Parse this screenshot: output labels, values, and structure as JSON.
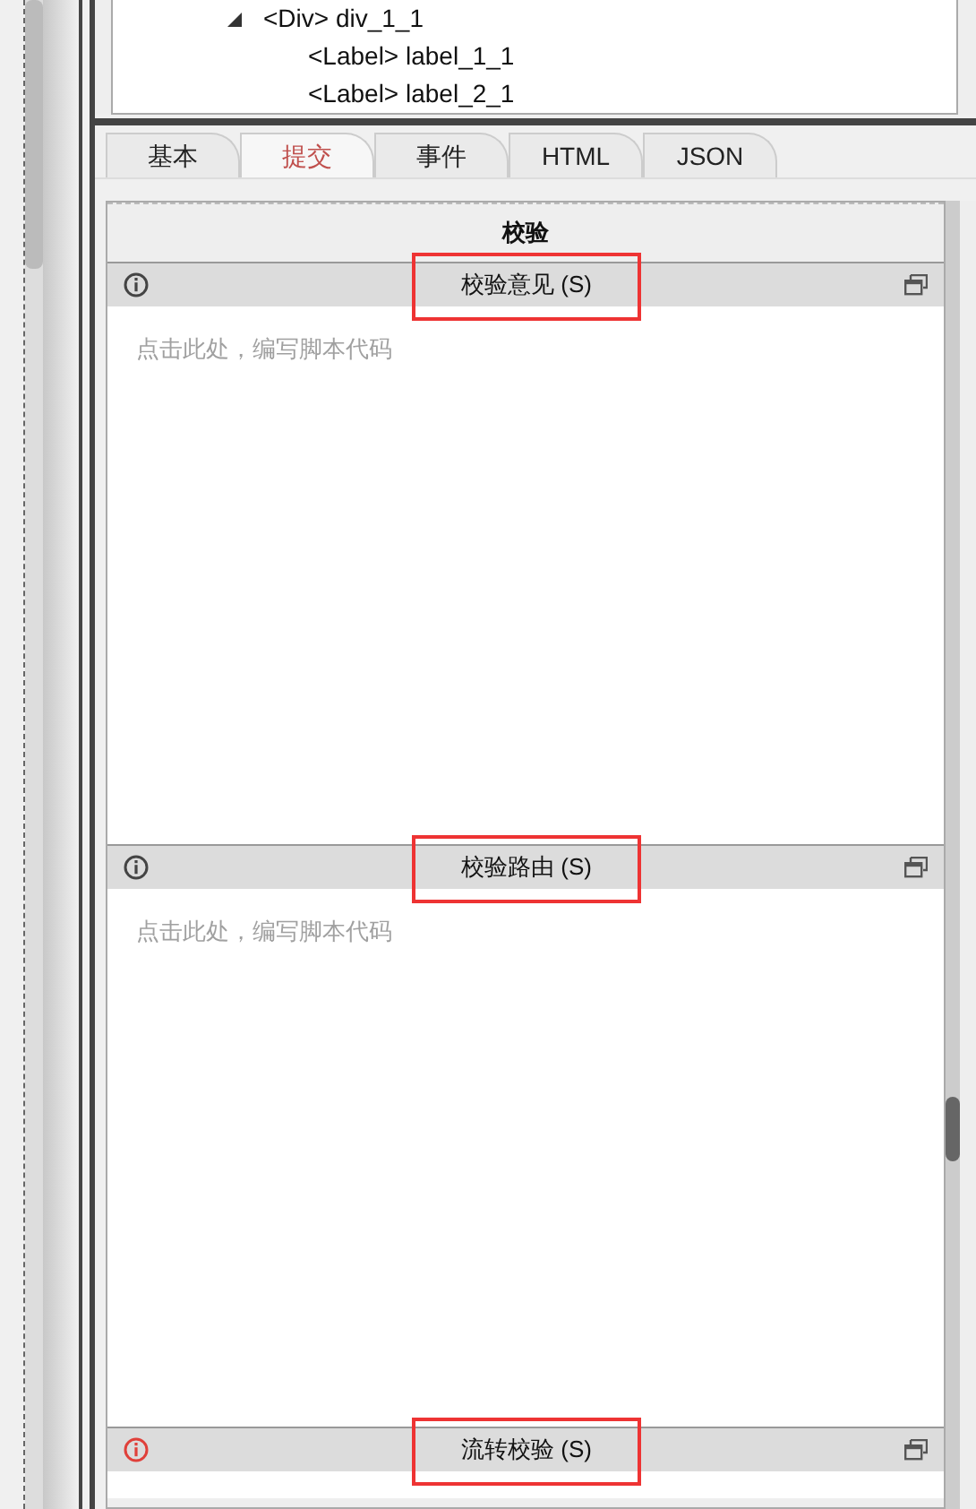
{
  "tree": {
    "items": [
      {
        "label": "<Div> div_1_1",
        "expanded": true,
        "children": [
          {
            "label": "<Label> label_1_1"
          },
          {
            "label": "<Label> label_2_1"
          }
        ]
      }
    ]
  },
  "tabs": [
    {
      "label": "基本",
      "selected": false
    },
    {
      "label": "提交",
      "selected": true
    },
    {
      "label": "事件",
      "selected": false
    },
    {
      "label": "HTML",
      "selected": false
    },
    {
      "label": "JSON",
      "selected": false
    }
  ],
  "panel": {
    "title": "校验",
    "sections": [
      {
        "title": "校验意见 (S)",
        "alert": false,
        "placeholder": "点击此处，编写脚本代码",
        "highlighted": true
      },
      {
        "title": "校验路由 (S)",
        "alert": false,
        "placeholder": "点击此处，编写脚本代码",
        "highlighted": true
      },
      {
        "title": "流转校验 (S)",
        "alert": true,
        "highlighted": true
      }
    ]
  }
}
